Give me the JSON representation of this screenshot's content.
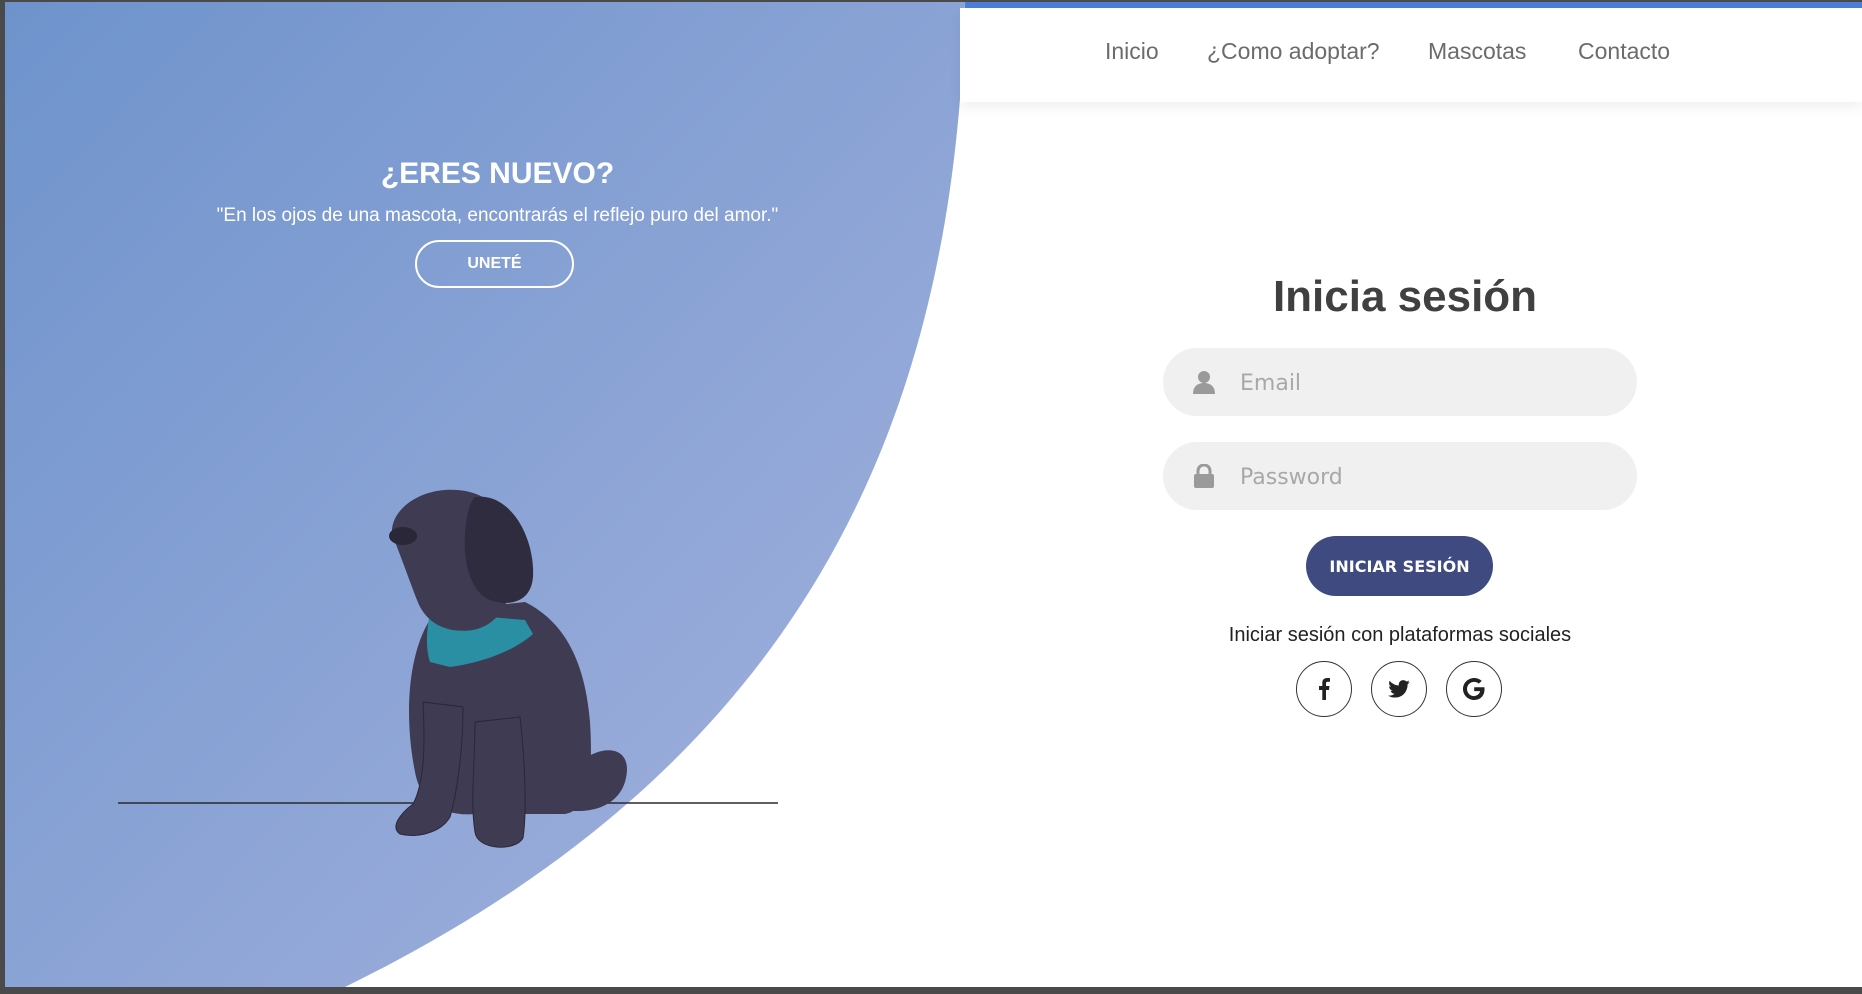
{
  "nav": {
    "items": [
      {
        "label": "Inicio"
      },
      {
        "label": "¿Como adoptar?"
      },
      {
        "label": "Mascotas"
      },
      {
        "label": "Contacto"
      }
    ]
  },
  "left_panel": {
    "title": "¿ERES NUEVO?",
    "quote": "\"En los ojos de una mascota, encontrarás el reflejo puro del amor.\"",
    "join_label": "UNETÉ"
  },
  "login": {
    "title": "Inicia sesión",
    "email_placeholder": "Email",
    "password_placeholder": "Password",
    "submit_label": "INICIAR SESIÓN",
    "social_text": "Iniciar sesión con plataformas sociales",
    "social_icons": [
      "facebook-icon",
      "twitter-icon",
      "google-icon"
    ]
  },
  "colors": {
    "accent": "#4a7fd6",
    "gradient_start": "#6e93cc",
    "gradient_end": "#a0b0dc",
    "button": "#3e4a80",
    "collar": "#2a8fa3",
    "dog_body": "#3f3b53"
  }
}
